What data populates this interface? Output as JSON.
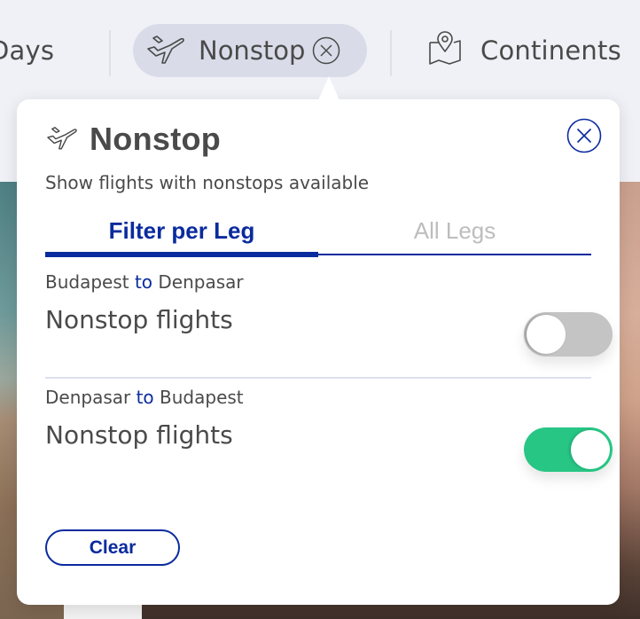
{
  "filter_bar": {
    "items": [
      {
        "label": "Days",
        "icon": null,
        "active": false
      },
      {
        "label": "Nonstop",
        "icon": "airplane-icon",
        "active": true,
        "removable": true
      },
      {
        "label": "Continents",
        "icon": "map-pin-icon",
        "active": false
      }
    ]
  },
  "popover": {
    "title": "Nonstop",
    "title_icon": "airplane-icon",
    "close_icon": "close-circle-icon",
    "subtitle": "Show flights with nonstops available",
    "tabs": [
      {
        "label": "Filter per Leg",
        "selected": true
      },
      {
        "label": "All Legs",
        "selected": false
      }
    ],
    "legs": [
      {
        "from": "Budapest",
        "connector": "to",
        "to": "Denpasar",
        "option_label": "Nonstop flights",
        "enabled": false
      },
      {
        "from": "Denpasar",
        "connector": "to",
        "to": "Budapest",
        "option_label": "Nonstop flights",
        "enabled": true
      }
    ],
    "clear_label": "Clear"
  },
  "colors": {
    "brand_blue": "#0a2b9e",
    "toggle_on": "#27c685",
    "toggle_off": "#c4c4c4",
    "chip_active_bg": "#d9dce8",
    "bar_bg": "#f0f1f6"
  }
}
